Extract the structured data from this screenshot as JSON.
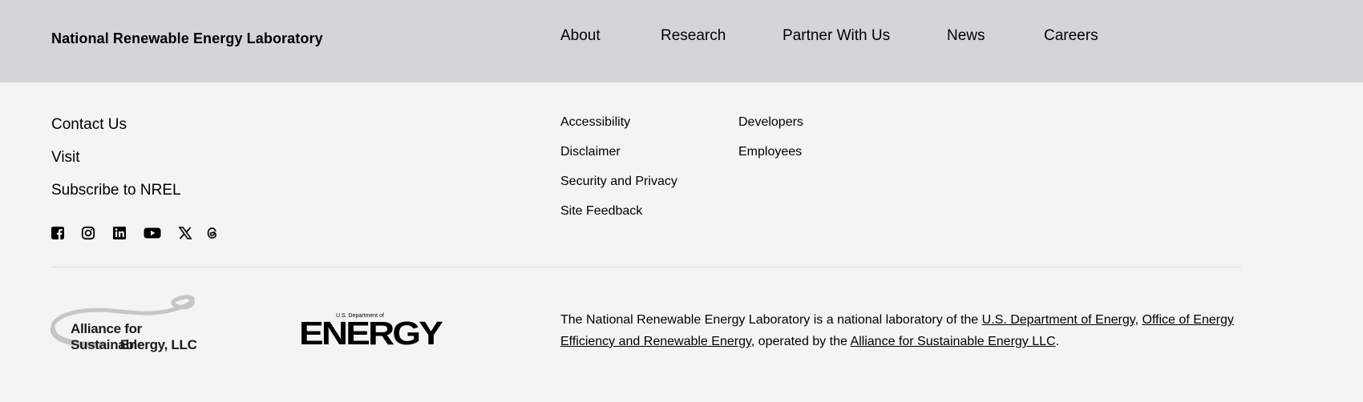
{
  "header": {
    "site_name": "National Renewable Energy Laboratory",
    "nav": [
      "About",
      "Research",
      "Partner With Us",
      "News",
      "Careers"
    ]
  },
  "footer": {
    "primary_links": [
      "Contact Us",
      "Visit",
      "Subscribe to NREL"
    ],
    "links_col1": [
      "Accessibility",
      "Disclaimer",
      "Security and Privacy",
      "Site Feedback"
    ],
    "links_col2": [
      "Developers",
      "Employees"
    ],
    "social_icons": [
      "facebook-icon",
      "instagram-icon",
      "linkedin-icon",
      "youtube-icon",
      "x-icon",
      "threads-icon"
    ],
    "logos": {
      "alliance_line1": "Alliance for Sustainable",
      "alliance_line2": "Energy, LLC",
      "doe_small": "U.S. Department of",
      "doe_big": "ENERGY"
    },
    "statement": {
      "prefix": "The National Renewable Energy Laboratory is a national laboratory of the ",
      "link1": "U.S. Department of Energy",
      "sep": ", ",
      "link2": "Office of Energy Efficiency and Renewable Energy",
      "middle": ", operated by the ",
      "link3": "Alliance for Sustainable Energy LLC",
      "suffix": "."
    }
  },
  "colors": {
    "header_bg": "#d3d6d9",
    "footer_bg": "#f4f4f4",
    "text": "#000000",
    "divider": "#dadada"
  }
}
